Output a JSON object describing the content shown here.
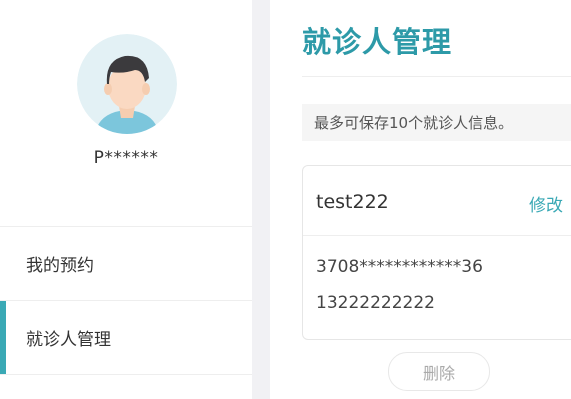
{
  "sidebar": {
    "username": "P******",
    "items": [
      {
        "label": "我的预约",
        "active": false
      },
      {
        "label": "就诊人管理",
        "active": true
      }
    ]
  },
  "main": {
    "title": "就诊人管理",
    "notice": "最多可保存10个就诊人信息。",
    "patient": {
      "name": "test222",
      "edit_label": "修改",
      "id_number": "3708************36",
      "phone": "13222222222"
    },
    "delete_label": "删除"
  },
  "colors": {
    "accent": "#3aa9b5",
    "title": "#2d9aa8",
    "page_bg": "#f1f1f4"
  },
  "icons": {
    "avatar": "user-avatar-icon"
  }
}
